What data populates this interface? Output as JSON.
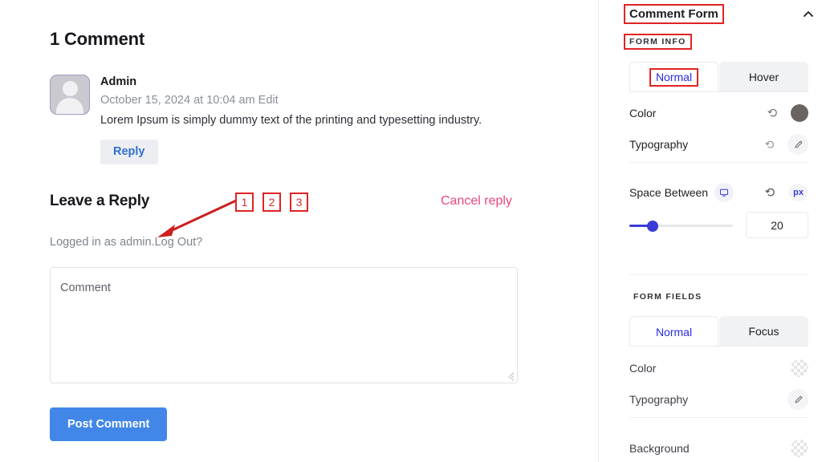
{
  "preview": {
    "comments_title": "1 Comment",
    "comment": {
      "author": "Admin",
      "meta": "October 15, 2024 at 10:04 am Edit",
      "text": "Lorem Ipsum is simply dummy text of the printing and typesetting industry.",
      "reply_label": "Reply",
      "avatar_name": "user-avatar"
    },
    "leave_a_reply": "Leave a Reply",
    "cancel_reply": "Cancel reply",
    "logged_in_prefix": "Logged in as admin.",
    "log_out": "Log Out?",
    "comment_placeholder": "Comment",
    "comment_value": "",
    "post_comment": "Post Comment",
    "annotations": {
      "box_1": "1",
      "box_2": "2",
      "box_3": "3"
    }
  },
  "panel": {
    "title": "Comment Form",
    "collapse_icon": "chevron-up-icon",
    "form_info": {
      "section_label": "FORM INFO",
      "tabs": [
        {
          "label": "Normal",
          "active": true
        },
        {
          "label": "Hover",
          "active": false
        }
      ],
      "rows": [
        {
          "label": "Color",
          "control": "color-swatch",
          "value": "#6b635f",
          "reset": "reset-icon"
        },
        {
          "label": "Typography",
          "control": "edit-pencil",
          "reset": "reset-icon"
        }
      ],
      "space_between": {
        "label": "Space Between",
        "device_icon": "desktop-icon",
        "reset": "reset-icon",
        "unit": "px",
        "value": "20",
        "slider_percent": 20
      }
    },
    "form_fields": {
      "section_label": "FORM FIELDS",
      "tabs": [
        {
          "label": "Normal",
          "active": true
        },
        {
          "label": "Focus",
          "active": false
        }
      ],
      "rows": [
        {
          "label": "Color",
          "control": "transparent-swatch"
        },
        {
          "label": "Typography",
          "control": "edit-pencil"
        },
        {
          "label": "Background",
          "control": "transparent-swatch"
        }
      ]
    }
  },
  "steps": {
    "badge_1": "1",
    "badge_2": "2",
    "badge_3": "3"
  },
  "colors": {
    "accent_blue": "#3b3bd6",
    "post_button": "#4287e8",
    "annotation_red": "#e02424",
    "badge_red": "#e60000",
    "cancel_pink": "#e8477e",
    "reply_link": "#2f6fd0"
  }
}
